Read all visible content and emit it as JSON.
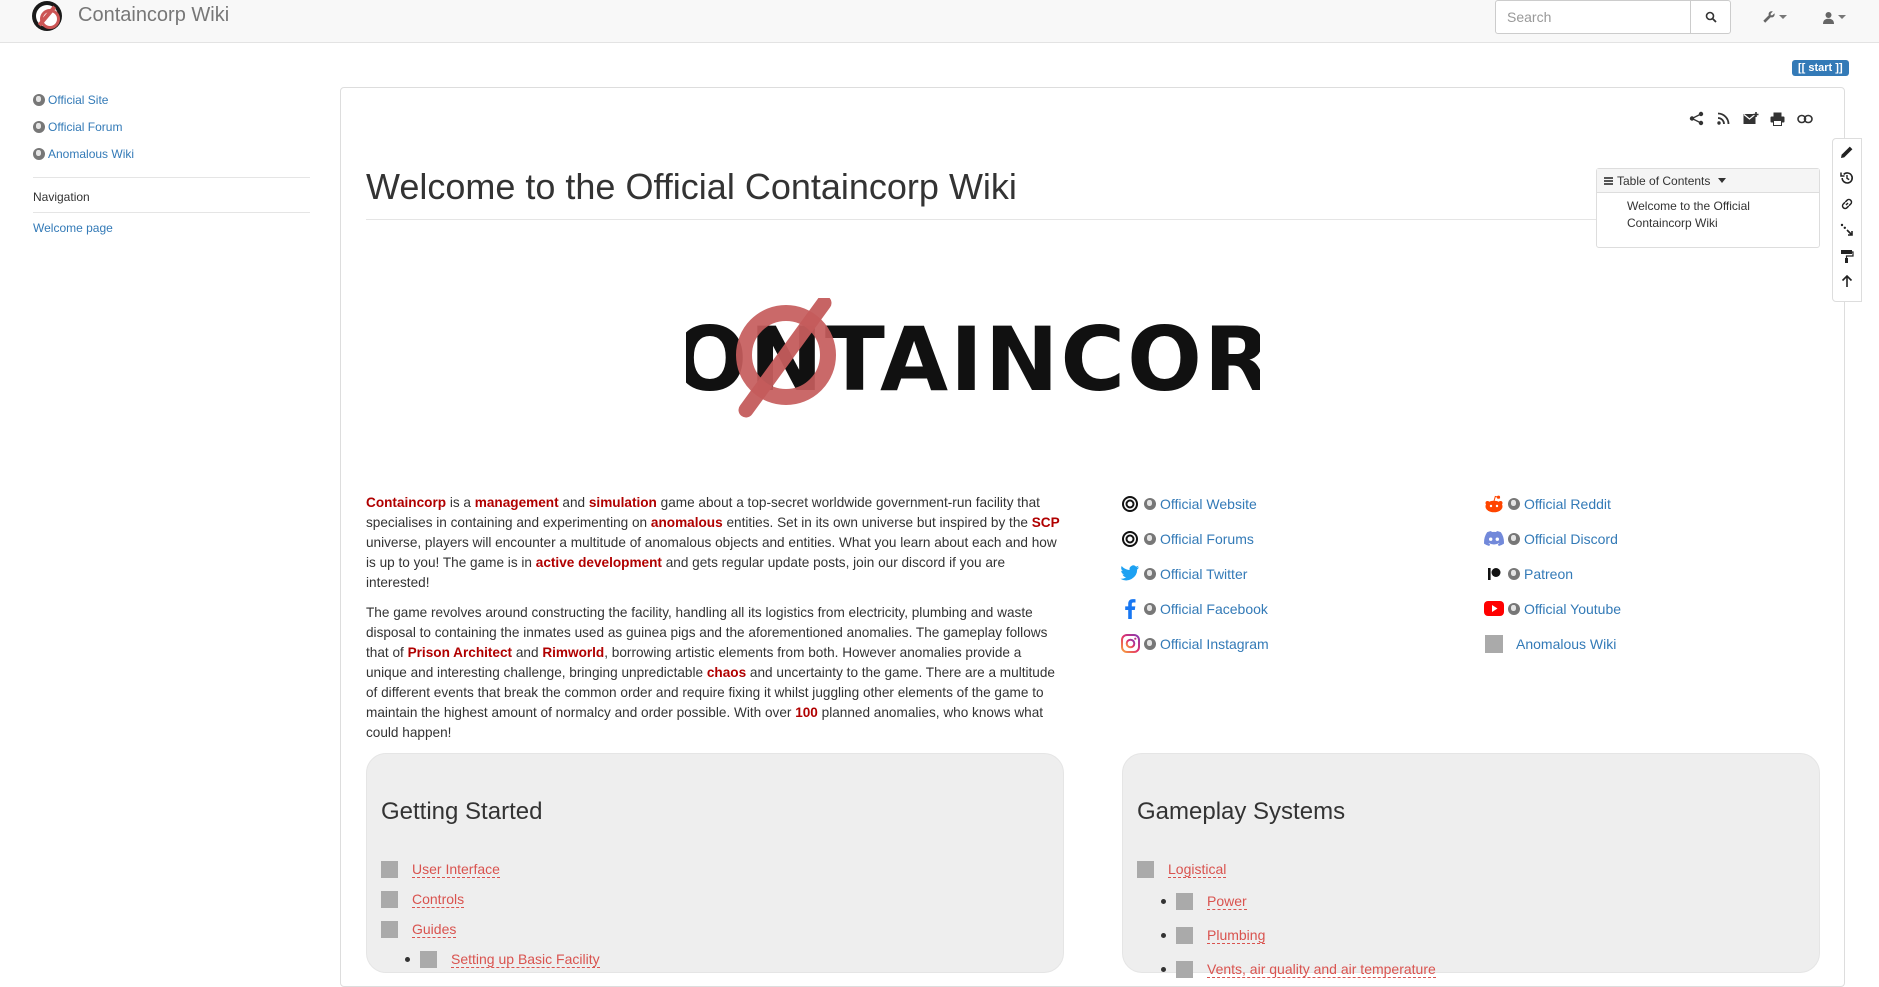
{
  "header": {
    "site_title": "Containcorp Wiki",
    "search_placeholder": "Search"
  },
  "sidebar": {
    "links": [
      {
        "label": "Official Site"
      },
      {
        "label": "Official Forum"
      },
      {
        "label": "Anomalous Wiki"
      }
    ],
    "nav_heading": "Navigation",
    "nav_links": [
      {
        "label": "Welcome page"
      }
    ]
  },
  "page": {
    "start_badge": "[[ start ]]",
    "title": "Welcome to the Official Containcorp Wiki",
    "toc": {
      "heading": "Table of Contents",
      "items": [
        "Welcome to the Official Containcorp Wiki"
      ]
    },
    "banner_text": "CONTAINCORP",
    "intro": {
      "p1": [
        {
          "t": "Containcorp",
          "b": true
        },
        {
          "t": " is a "
        },
        {
          "t": "management",
          "b": true
        },
        {
          "t": " and "
        },
        {
          "t": "simulation",
          "b": true
        },
        {
          "t": " game about a top-secret worldwide government-run facility that specialises in containing and experimenting on "
        },
        {
          "t": "anomalous",
          "b": true
        },
        {
          "t": " entities. Set in its own universe but inspired by the "
        },
        {
          "t": "SCP",
          "b": true
        },
        {
          "t": " universe, players will encounter a multitude of anomalous objects and entities. What you learn about each and how is up to you! The game is in "
        },
        {
          "t": "active development",
          "b": true
        },
        {
          "t": " and gets regular update posts, join our discord if you are interested!"
        }
      ],
      "p2": [
        {
          "t": "The game revolves around constructing the facility, handling all its logistics from electricity, plumbing and waste disposal to containing the inmates used as guinea pigs and the aforementioned anomalies. The gameplay follows that of "
        },
        {
          "t": "Prison Architect",
          "b": true
        },
        {
          "t": " and "
        },
        {
          "t": "Rimworld",
          "b": true
        },
        {
          "t": ", borrowing artistic elements from both. However anomalies provide a unique and interesting challenge, bringing unpredictable "
        },
        {
          "t": "chaos",
          "b": true
        },
        {
          "t": " and uncertainty to the game. There are a multitude of different events that break the common order and require fixing it whilst juggling other elements of the game to maintain the highest amount of normalcy and order possible. With over "
        },
        {
          "t": "100",
          "b": true
        },
        {
          "t": " planned anomalies, who knows what could happen!"
        }
      ]
    },
    "links_left": [
      {
        "label": "Official Website",
        "icon": "containcorp-icon"
      },
      {
        "label": "Official Forums",
        "icon": "containcorp-icon"
      },
      {
        "label": "Official Twitter",
        "icon": "twitter-icon"
      },
      {
        "label": "Official Facebook",
        "icon": "facebook-icon"
      },
      {
        "label": "Official Instagram",
        "icon": "instagram-icon"
      }
    ],
    "links_right": [
      {
        "label": "Official Reddit",
        "icon": "reddit-icon"
      },
      {
        "label": "Official Discord",
        "icon": "discord-icon"
      },
      {
        "label": "Patreon",
        "icon": "patreon-icon"
      },
      {
        "label": "Official Youtube",
        "icon": "youtube-icon"
      },
      {
        "label": "Anomalous Wiki",
        "icon": "placeholder-image-icon"
      }
    ],
    "getting_started": {
      "heading": "Getting Started",
      "items": [
        "User Interface",
        "Controls",
        "Guides"
      ],
      "sub_items": [
        "Setting up Basic Facility"
      ]
    },
    "gameplay_systems": {
      "heading": "Gameplay Systems",
      "items": [
        "Logistical"
      ],
      "sub_items": [
        "Power",
        "Plumbing",
        "Vents, air quality and air temperature"
      ]
    }
  },
  "colors": {
    "link": "#337ab7",
    "highlight": "#b00000",
    "broken_link": "#d9534f",
    "logo_red": "#c55c5c"
  }
}
